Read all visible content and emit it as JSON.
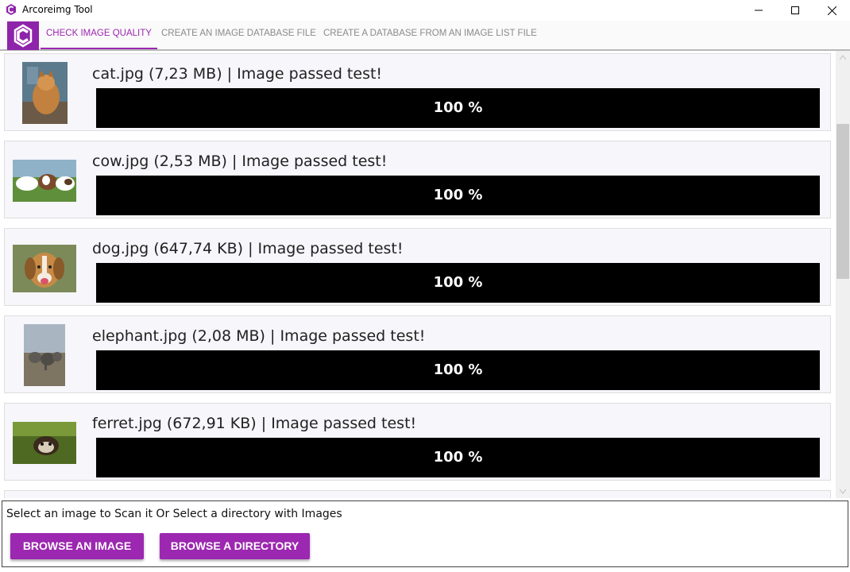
{
  "window": {
    "title": "Arcoreimg Tool"
  },
  "tabs": [
    {
      "label": "CHECK IMAGE QUALITY",
      "active": true
    },
    {
      "label": "CREATE AN IMAGE DATABASE FILE",
      "active": false
    },
    {
      "label": "CREATE A DATABASE FROM AN IMAGE LIST FILE",
      "active": false
    }
  ],
  "colors": {
    "accent": "#9c27b0",
    "progress_fill": "#000000",
    "card_bg": "#f6f6fb"
  },
  "images": [
    {
      "title": "cat.jpg (7,23 MB) | Image passed test!",
      "progress": 100,
      "progress_label": "100 %",
      "thumb_icon": "cat-photo"
    },
    {
      "title": "cow.jpg (2,53 MB) | Image passed test!",
      "progress": 100,
      "progress_label": "100 %",
      "thumb_icon": "cow-photo"
    },
    {
      "title": "dog.jpg (647,74 KB) | Image passed test!",
      "progress": 100,
      "progress_label": "100 %",
      "thumb_icon": "dog-photo"
    },
    {
      "title": "elephant.jpg (2,08 MB) | Image passed test!",
      "progress": 100,
      "progress_label": "100 %",
      "thumb_icon": "elephant-photo"
    },
    {
      "title": "ferret.jpg (672,91 KB) | Image passed test!",
      "progress": 100,
      "progress_label": "100 %",
      "thumb_icon": "ferret-photo"
    }
  ],
  "footer": {
    "hint": "Select an image to Scan it Or Select a directory with Images",
    "browse_image_label": "BROWSE AN IMAGE",
    "browse_directory_label": "BROWSE A DIRECTORY"
  }
}
